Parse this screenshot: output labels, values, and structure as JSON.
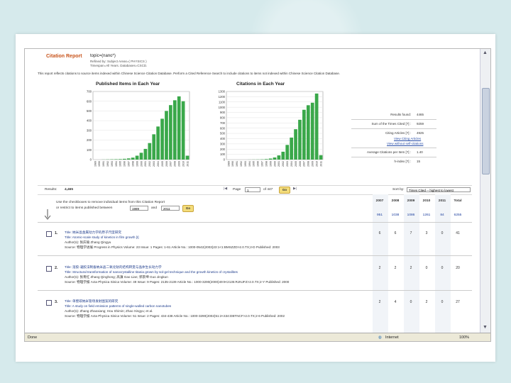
{
  "header": {
    "title": "Citation Report",
    "query": "topic=(nano*)",
    "refined": "Refined by: Subject Areas=( PHYSICS )",
    "timespan": "Timespan=All Years. Databases=CSCD.",
    "note": "This report reflects citations to source items indexed within Chinese Science Citation Database. Perform a Cited Reference Search to include citations to items not indexed within Chinese Science Citation Database."
  },
  "charts": [
    {
      "title": "Published Items in Each Year",
      "yticks": [
        "700",
        "600",
        "500",
        "400",
        "300",
        "200",
        "100",
        "0"
      ],
      "ymax": 700,
      "categories": [
        "1989",
        "1990",
        "1991",
        "1992",
        "1993",
        "1994",
        "1995",
        "1996",
        "1997",
        "1998",
        "1999",
        "2000",
        "2001",
        "2002",
        "2003",
        "2004",
        "2005",
        "2006",
        "2007",
        "2008",
        "2009",
        "2010",
        "2011"
      ],
      "values": [
        0,
        0,
        1,
        2,
        3,
        4,
        5,
        8,
        12,
        20,
        40,
        70,
        110,
        170,
        260,
        340,
        420,
        500,
        560,
        610,
        650,
        600,
        40
      ]
    },
    {
      "title": "Citations in Each Year",
      "yticks": [
        "1300",
        "1200",
        "1100",
        "1000",
        "900",
        "800",
        "700",
        "600",
        "500",
        "400",
        "300",
        "200",
        "100",
        "0"
      ],
      "ymax": 1300,
      "categories": [
        "1989",
        "1990",
        "1991",
        "1992",
        "1993",
        "1994",
        "1995",
        "1996",
        "1997",
        "1998",
        "1999",
        "2000",
        "2001",
        "2002",
        "2003",
        "2004",
        "2005",
        "2006",
        "2007",
        "2008",
        "2009",
        "2010",
        "2011"
      ],
      "values": [
        0,
        0,
        0,
        0,
        0,
        1,
        2,
        3,
        5,
        10,
        20,
        40,
        80,
        150,
        280,
        420,
        580,
        760,
        951,
        1038,
        1086,
        1261,
        84
      ]
    }
  ],
  "chart_data": [
    {
      "type": "bar",
      "title": "Published Items in Each Year",
      "categories": [
        "1989",
        "1990",
        "1991",
        "1992",
        "1993",
        "1994",
        "1995",
        "1996",
        "1997",
        "1998",
        "1999",
        "2000",
        "2001",
        "2002",
        "2003",
        "2004",
        "2005",
        "2006",
        "2007",
        "2008",
        "2009",
        "2010",
        "2011"
      ],
      "values": [
        0,
        0,
        1,
        2,
        3,
        4,
        5,
        8,
        12,
        20,
        40,
        70,
        110,
        170,
        260,
        340,
        420,
        500,
        560,
        610,
        650,
        600,
        40
      ],
      "ylim": [
        0,
        700
      ]
    },
    {
      "type": "bar",
      "title": "Citations in Each Year",
      "categories": [
        "1989",
        "1990",
        "1991",
        "1992",
        "1993",
        "1994",
        "1995",
        "1996",
        "1997",
        "1998",
        "1999",
        "2000",
        "2001",
        "2002",
        "2003",
        "2004",
        "2005",
        "2006",
        "2007",
        "2008",
        "2009",
        "2010",
        "2011"
      ],
      "values": [
        0,
        0,
        0,
        0,
        0,
        1,
        2,
        3,
        5,
        10,
        20,
        40,
        80,
        150,
        280,
        420,
        580,
        760,
        951,
        1038,
        1086,
        1261,
        84
      ],
      "ylim": [
        0,
        1300
      ]
    }
  ],
  "stats": {
    "results_found_label": "Results found:",
    "results_found": "4465",
    "sum_cited_label": "Sum of the Times Cited [?] :",
    "sum_cited": "9259",
    "citing_articles_label": "Citing Articles [?] :",
    "citing_articles": "4925",
    "view_citing": "View Citing Articles",
    "view_without_self": "View without self-citations",
    "avg_citations_label": "Average Citations per Item [?] :",
    "avg_citations": "1.40",
    "h_index_label": "h-index [?] :",
    "h_index": "15"
  },
  "results_bar": {
    "results_label": "Results:",
    "results_count": "4,465",
    "page_label": "Page",
    "page_value": "1",
    "of_pages": "of 447",
    "go": "Go",
    "sort_label": "Sort by:",
    "sort_value": "Times Cited -- highest to lowest"
  },
  "filter": {
    "line1": "Use the checkboxes to remove individual items from this Citation Report",
    "line2": "or restrict to items published between",
    "from_year": "1989",
    "and": "and",
    "to_year": "2011",
    "go": "Go"
  },
  "years": {
    "headers": [
      "2007",
      "2008",
      "2009",
      "2010",
      "2011",
      "Total"
    ],
    "totals": [
      "951",
      "1038",
      "1086",
      "1261",
      "84",
      "6255"
    ]
  },
  "records": [
    {
      "num": "1.",
      "title_cn": "Title: 纳米晶金属动力学的原子尺度研究",
      "title": "Title: Atomic-scale study of kinetics in film growth [I]",
      "authors": "Author(s): 张庆瑜 Zhang Qingyu",
      "source": "Source: 物理学进展 Progress in Physics  Volume: 23  Issue: 1  Pages: 1-61  Article No.: 1000-0542(2003)23:1<1:BMSZZD>2.0.TX;2-D  Published: 2003",
      "counts": [
        "6",
        "6",
        "7",
        "3",
        "0",
        "41"
      ]
    },
    {
      "num": "2.",
      "title_cn": "Title: 溶胶-凝胶法制备纳米晶二氧化钛的结构转变与晶体生长动力学",
      "title": "Title: Structural transformation of nanocrystalline titania grown by sol-gel technique and the growth kinetics of crystallites",
      "authors": "Author(s): 张青红 Zhang Qinghong; 高濂 Gao Lian; 郭景坤 Guo Jingkun",
      "source": "Source: 物理学报 Acta Physica Sinica  Volume: 49  Issue: 9  Pages: 2135-2139  Article No.: 1000-3290(2000)49:9<2135:RJNJFZ>2.0.TX;2-Y  Published: 2000",
      "counts": [
        "2",
        "2",
        "2",
        "0",
        "0",
        "20"
      ]
    },
    {
      "num": "3.",
      "title_cn": "Title: 单壁碳纳米管场发射图案的研究",
      "title": "Title: A study on field emission patterns of single-walled carbon nanotubes",
      "authors": "Author(s): Zhang Zhaoxiang; Hou Shimin; Zhao Xingyu; et al.",
      "source": "Source: 物理学报 Acta Physica Sinica  Volume: 51  Issue: 2  Pages: 434-438  Article No.: 1000-3290(2002)51:2<434:DBTNCF>2.0.TX;2-6  Published: 2002",
      "counts": [
        "2",
        "4",
        "0",
        "2",
        "0",
        "27"
      ]
    }
  ],
  "statusbar": {
    "left": "Done",
    "zone": "Internet",
    "zoom": "100%"
  },
  "colors": {
    "bar": "#3aa84a",
    "title": "#c8531a",
    "link": "#2a4fa8"
  }
}
